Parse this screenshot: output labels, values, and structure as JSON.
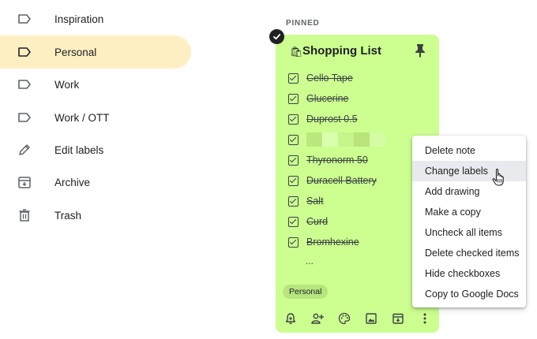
{
  "sidebar": {
    "items": [
      {
        "label": "Inspiration",
        "icon": "label-icon"
      },
      {
        "label": "Personal",
        "icon": "label-icon",
        "active": true
      },
      {
        "label": "Work",
        "icon": "label-icon"
      },
      {
        "label": "Work / OTT",
        "icon": "label-icon"
      },
      {
        "label": "Edit labels",
        "icon": "pencil-icon"
      },
      {
        "label": "Archive",
        "icon": "archive-icon"
      },
      {
        "label": "Trash",
        "icon": "trash-icon"
      }
    ]
  },
  "main": {
    "section_label": "PINNED",
    "note": {
      "title": "Shopping List",
      "color": "#ccff90",
      "items": [
        {
          "text": "Cello Tape",
          "checked": true
        },
        {
          "text": "Glucerine",
          "checked": true
        },
        {
          "text": "Duprost 0.5",
          "checked": true
        },
        {
          "text": "",
          "checked": true,
          "redacted": true
        },
        {
          "text": "Thyronorm 50",
          "checked": true
        },
        {
          "text": "Duracell Battery",
          "checked": true
        },
        {
          "text": "Salt",
          "checked": true
        },
        {
          "text": "Curd",
          "checked": true
        },
        {
          "text": "Bromhexine",
          "checked": true
        }
      ],
      "more": "...",
      "label_chip": "Personal",
      "toolbar_icons": [
        "remind-me-icon",
        "collaborator-icon",
        "palette-icon",
        "image-icon",
        "archive-icon",
        "more-icon"
      ]
    }
  },
  "context_menu": {
    "items": [
      "Delete note",
      "Change labels",
      "Add drawing",
      "Make a copy",
      "Uncheck all items",
      "Delete checked items",
      "Hide checkboxes",
      "Copy to Google Docs"
    ],
    "hovered": "Change labels"
  },
  "colors": {
    "active_sidebar": "#feefc3",
    "note_background": "#ccff90",
    "chip_background": "#b7e580",
    "menu_hover": "#e8eaed"
  }
}
